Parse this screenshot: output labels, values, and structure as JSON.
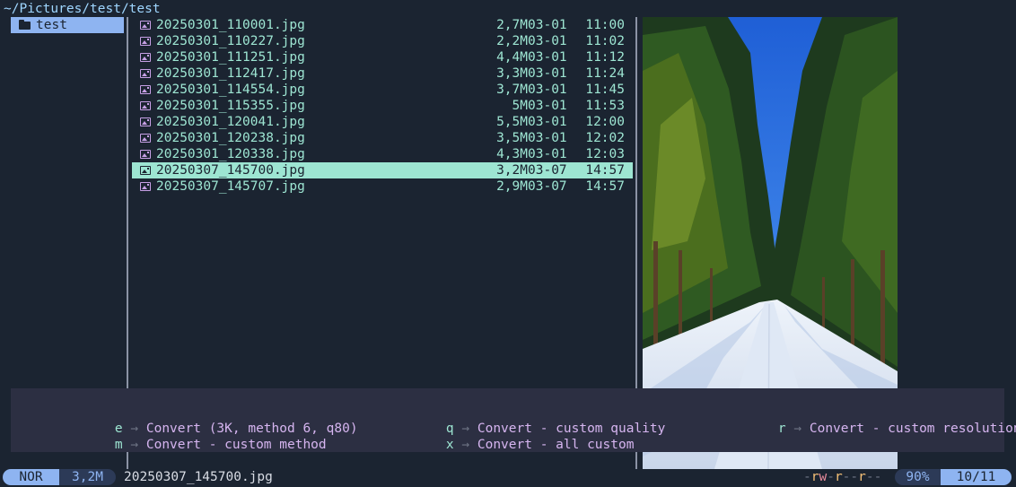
{
  "header": {
    "path": "~/Pictures/test/test"
  },
  "parent": {
    "items": [
      {
        "label": "test",
        "icon": "folder-icon"
      }
    ]
  },
  "files": [
    {
      "name": "20250301_110001.jpg",
      "size": "2,7M",
      "date": "03-01",
      "time": "11:00"
    },
    {
      "name": "20250301_110227.jpg",
      "size": "2,2M",
      "date": "03-01",
      "time": "11:02"
    },
    {
      "name": "20250301_111251.jpg",
      "size": "4,4M",
      "date": "03-01",
      "time": "11:12"
    },
    {
      "name": "20250301_112417.jpg",
      "size": "3,3M",
      "date": "03-01",
      "time": "11:24"
    },
    {
      "name": "20250301_114554.jpg",
      "size": "3,7M",
      "date": "03-01",
      "time": "11:45"
    },
    {
      "name": "20250301_115355.jpg",
      "size": "5M",
      "date": "03-01",
      "time": "11:53"
    },
    {
      "name": "20250301_120041.jpg",
      "size": "5,5M",
      "date": "03-01",
      "time": "12:00"
    },
    {
      "name": "20250301_120238.jpg",
      "size": "3,5M",
      "date": "03-01",
      "time": "12:02"
    },
    {
      "name": "20250301_120338.jpg",
      "size": "4,3M",
      "date": "03-01",
      "time": "12:03"
    },
    {
      "name": "20250307_145700.jpg",
      "size": "3,2M",
      "date": "03-07",
      "time": "14:57",
      "selected": true
    },
    {
      "name": "20250307_145707.jpg",
      "size": "2,9M",
      "date": "03-07",
      "time": "14:57"
    }
  ],
  "popup": {
    "commands": [
      {
        "key": "e",
        "arrow": "→",
        "label": "Convert (3K, method 6, q80)"
      },
      {
        "key": "m",
        "arrow": "→",
        "label": "Convert - custom method"
      },
      {
        "key": "q",
        "arrow": "→",
        "label": "Convert - custom quality"
      },
      {
        "key": "x",
        "arrow": "→",
        "label": "Convert - all custom"
      },
      {
        "key": "r",
        "arrow": "→",
        "label": "Convert - custom resolution"
      }
    ]
  },
  "statusbar": {
    "mode": "NOR",
    "size": "3,2M",
    "filename": "20250307_145700.jpg",
    "permissions": "-rw-r--r--",
    "percent": "90%",
    "position": "10/11"
  },
  "colors": {
    "background": "#1b2431",
    "accent": "#8eb4f1",
    "selection": "#9de5d2",
    "popup_bg": "#2c2f42",
    "command_text": "#d6b5f0",
    "icon": "#c7a0e6"
  }
}
